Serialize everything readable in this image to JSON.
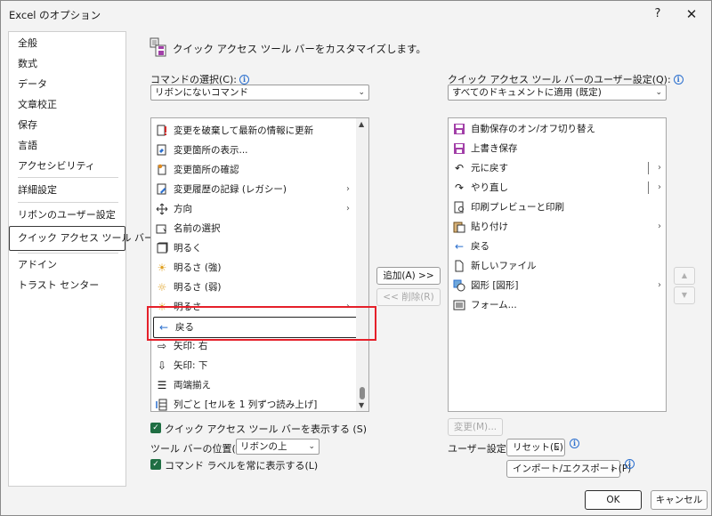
{
  "window": {
    "title": "Excel のオプション",
    "help": "?",
    "close": "✕"
  },
  "nav": {
    "items": [
      {
        "label": "全般"
      },
      {
        "label": "数式"
      },
      {
        "label": "データ"
      },
      {
        "label": "文章校正"
      },
      {
        "label": "保存"
      },
      {
        "label": "言語"
      },
      {
        "label": "アクセシビリティ"
      },
      {
        "label": "詳細設定"
      },
      {
        "label": "リボンのユーザー設定"
      },
      {
        "label": "クイック アクセス ツール バー",
        "selected": true
      },
      {
        "label": "アドイン"
      },
      {
        "label": "トラスト センター"
      }
    ]
  },
  "heading": "クイック アクセス ツール バーをカスタマイズします。",
  "left": {
    "choose_label": "コマンドの選択(C):",
    "choose_value": "リボンにないコマンド",
    "commands": [
      {
        "label": "変更を破棄して最新の情報に更新",
        "icon": "refresh-discard-icon"
      },
      {
        "label": "変更箇所の表示...",
        "icon": "show-changes-icon"
      },
      {
        "label": "変更箇所の確認",
        "icon": "review-changes-icon"
      },
      {
        "label": "変更履歴の記録 (レガシー)",
        "icon": "track-changes-icon",
        "submenu": true
      },
      {
        "label": "方向",
        "icon": "orientation-icon",
        "submenu": true
      },
      {
        "label": "名前の選択",
        "icon": "name-select-icon"
      },
      {
        "label": "明るく",
        "icon": "brighter-icon"
      },
      {
        "label": "明るさ (強)",
        "icon": "brightness-high-icon"
      },
      {
        "label": "明るさ (弱)",
        "icon": "brightness-low-icon"
      },
      {
        "label": "明るさ",
        "icon": "brightness-icon",
        "submenu": true
      },
      {
        "label": "戻る",
        "icon": "back-arrow-icon"
      },
      {
        "label": "矢印: 右",
        "icon": "arrow-right-icon"
      },
      {
        "label": "矢印: 下",
        "icon": "arrow-down-icon"
      },
      {
        "label": "両端揃え",
        "icon": "justify-icon"
      },
      {
        "label": "列ごと [セルを 1 列ずつ読み上げ]",
        "icon": "speak-by-column-icon"
      }
    ],
    "show_toolbar_label": "クイック アクセス ツール バーを表示する (S)",
    "position_label": "ツール バーの位置(O)",
    "position_value": "リボンの上",
    "show_labels_label": "コマンド ラベルを常に表示する(L)"
  },
  "middle": {
    "add": "追加(A) >>",
    "remove": "<< 削除(R)"
  },
  "right": {
    "customize_label": "クイック アクセス ツール バーのユーザー設定(Q):",
    "customize_value": "すべてのドキュメントに適用 (既定)",
    "commands": [
      {
        "label": "自動保存のオン/オフ切り替え",
        "icon": "autosave-icon"
      },
      {
        "label": "上書き保存",
        "icon": "save-icon"
      },
      {
        "label": "元に戻す",
        "icon": "undo-icon",
        "split": true
      },
      {
        "label": "やり直し",
        "icon": "redo-icon",
        "split": true
      },
      {
        "label": "印刷プレビューと印刷",
        "icon": "print-preview-icon"
      },
      {
        "label": "貼り付け",
        "icon": "paste-icon",
        "submenu": true
      },
      {
        "label": "戻る",
        "icon": "back-arrow-icon"
      },
      {
        "label": "新しいファイル",
        "icon": "new-file-icon"
      },
      {
        "label": "図形 [図形]",
        "icon": "shapes-icon",
        "submenu": true
      },
      {
        "label": "フォーム...",
        "icon": "form-icon"
      }
    ],
    "modify": "変更(M)...",
    "user_settings_label": "ユーザー設定:",
    "reset": "リセット(E)",
    "import_export": "インポート/エクスポート(P)"
  },
  "footer": {
    "ok": "OK",
    "cancel": "キャンセル"
  },
  "colors": {
    "highlight": "#e5202a",
    "checkbox": "#1f6e43",
    "info": "#2b6fce",
    "save_purple": "#a23fa8"
  }
}
